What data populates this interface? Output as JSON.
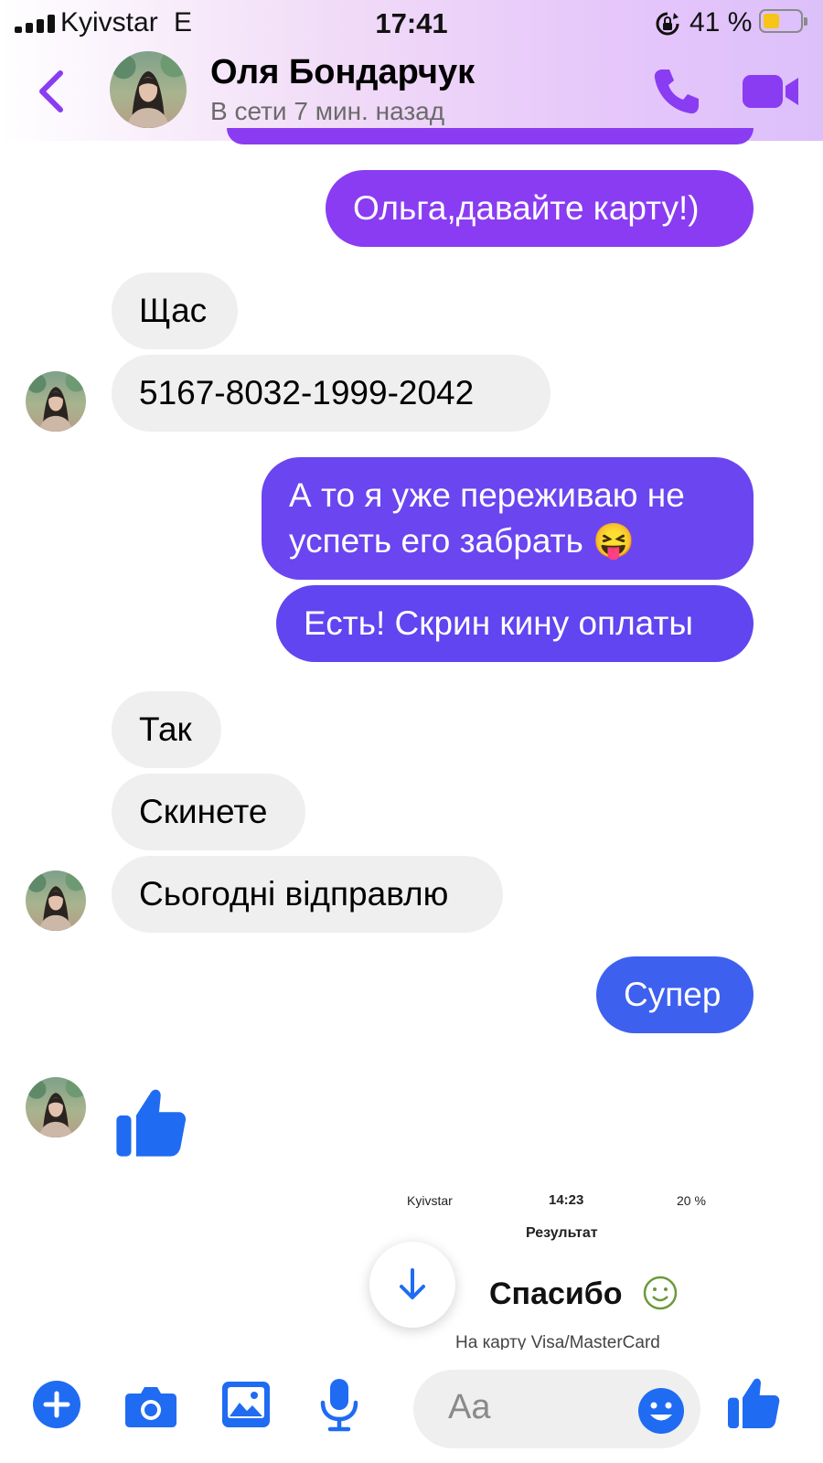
{
  "colors": {
    "accent": "#8a3cf2",
    "like_blue": "#1f6bf2"
  },
  "status_bar": {
    "carrier": "Kyivstar",
    "network": "E",
    "time": "17:41",
    "battery": "41 %"
  },
  "header": {
    "contact_name": "Оля Бондарчук",
    "status": "В сети 7 мин. назад",
    "icons": [
      "back-chevron-icon",
      "phone-icon",
      "video-camera-icon"
    ]
  },
  "messages": [
    {
      "from": "me",
      "text": "Ольга,давайте карту!)"
    },
    {
      "from": "contact",
      "text": "Щас"
    },
    {
      "from": "contact",
      "text": "5167-8032-1999-2042"
    },
    {
      "from": "me",
      "line1": "А то я уже переживаю не",
      "line2": "успеть его забрать 😝"
    },
    {
      "from": "me",
      "text": "Есть! Скрин кину оплаты"
    },
    {
      "from": "contact",
      "text": "Так"
    },
    {
      "from": "contact",
      "text": "Скинете"
    },
    {
      "from": "contact",
      "text": "Сьогодні відправлю"
    },
    {
      "from": "me",
      "text": "Супер"
    },
    {
      "from": "contact",
      "icon": "thumbs-up-icon"
    }
  ],
  "screenshot": {
    "carrier": "Kyivstar",
    "time": "14:23",
    "battery": "20 %",
    "title": "Результат",
    "thanks": "Спасибо",
    "card_text": "На карту Visa/MasterCard"
  },
  "composer": {
    "placeholder": "Aa",
    "icons": [
      "plus-icon",
      "camera-icon",
      "gallery-icon",
      "microphone-icon",
      "emoji-icon",
      "thumbs-up-icon"
    ]
  }
}
